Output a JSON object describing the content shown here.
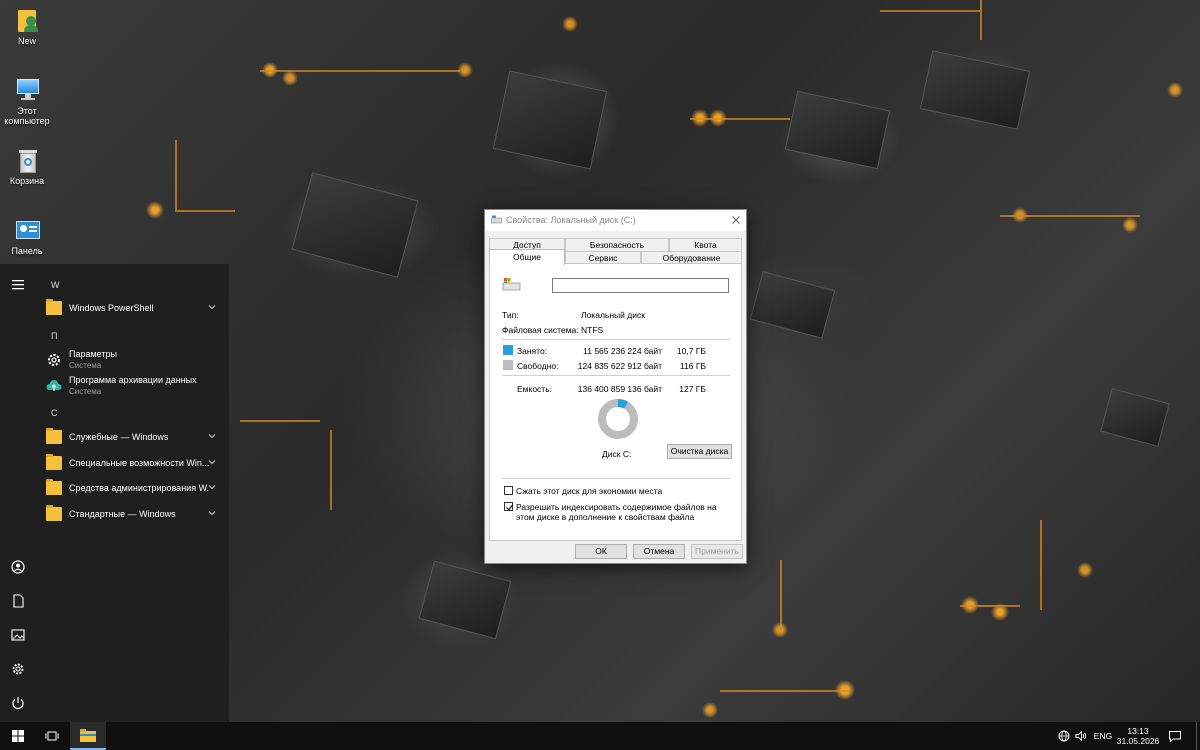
{
  "desktop": {
    "icons": [
      {
        "label": "New",
        "icon": "user-folder-icon"
      },
      {
        "label": "Этот компьютер",
        "icon": "computer-icon"
      },
      {
        "label": "Корзина",
        "icon": "recycle-bin-icon"
      },
      {
        "label": "Панель",
        "icon": "control-panel-icon"
      }
    ]
  },
  "start_menu": {
    "sections": [
      {
        "letter": "W",
        "items": [
          {
            "label": "Windows PowerShell",
            "icon": "folder-icon",
            "expandable": true
          }
        ]
      },
      {
        "letter": "П",
        "items": [
          {
            "label": "Параметры",
            "sub": "Система",
            "icon": "gear-icon"
          },
          {
            "label": "Программа архивации данных",
            "sub": "Система",
            "icon": "backup-cloud-icon"
          }
        ]
      },
      {
        "letter": "С",
        "items": [
          {
            "label": "Служебные — Windows",
            "icon": "folder-icon",
            "expandable": true
          },
          {
            "label": "Специальные возможности Win...",
            "icon": "folder-icon",
            "expandable": true
          },
          {
            "label": "Средства администрирования W...",
            "icon": "folder-icon",
            "expandable": true
          },
          {
            "label": "Стандартные — Windows",
            "icon": "folder-icon",
            "expandable": true
          }
        ]
      }
    ],
    "rail": [
      "hamburger-icon",
      "user-icon",
      "document-icon",
      "pictures-icon",
      "gear-icon",
      "power-icon"
    ]
  },
  "dialog": {
    "title": "Свойства: Локальный диск (C:)",
    "tabs_row1": [
      "Доступ",
      "Безопасность",
      "Квота"
    ],
    "tabs_row2": [
      "Общие",
      "Сервис",
      "Оборудование"
    ],
    "active_tab": "Общие",
    "name_field_value": "",
    "type_label": "Тип:",
    "type_value": "Локальный диск",
    "fs_label": "Файловая система:",
    "fs_value": "NTFS",
    "used_label": "Занято:",
    "used_bytes": "11 565 236 224 байт",
    "used_gb": "10,7 ГБ",
    "free_label": "Свободно:",
    "free_bytes": "124 835 622 912 байт",
    "free_gb": "116 ГБ",
    "capacity_label": "Емкость:",
    "capacity_bytes": "136 400 859 136 байт",
    "capacity_gb": "127 ГБ",
    "used_fraction": 0.085,
    "used_color": "#26a0da",
    "free_color": "#bcbcbc",
    "disk_label": "Диск C:",
    "cleanup_button": "Очистка диска",
    "compress_label": "Сжать этот диск для экономии места",
    "compress_checked": false,
    "index_label": "Разрешить индексировать содержимое файлов на этом диске в дополнение к свойствам файла",
    "index_checked": true,
    "ok_button": "ОК",
    "cancel_button": "Отмена",
    "apply_button": "Применить"
  },
  "taskbar": {
    "language": "ENG",
    "time": "13:13",
    "date": "31.05.2026"
  }
}
